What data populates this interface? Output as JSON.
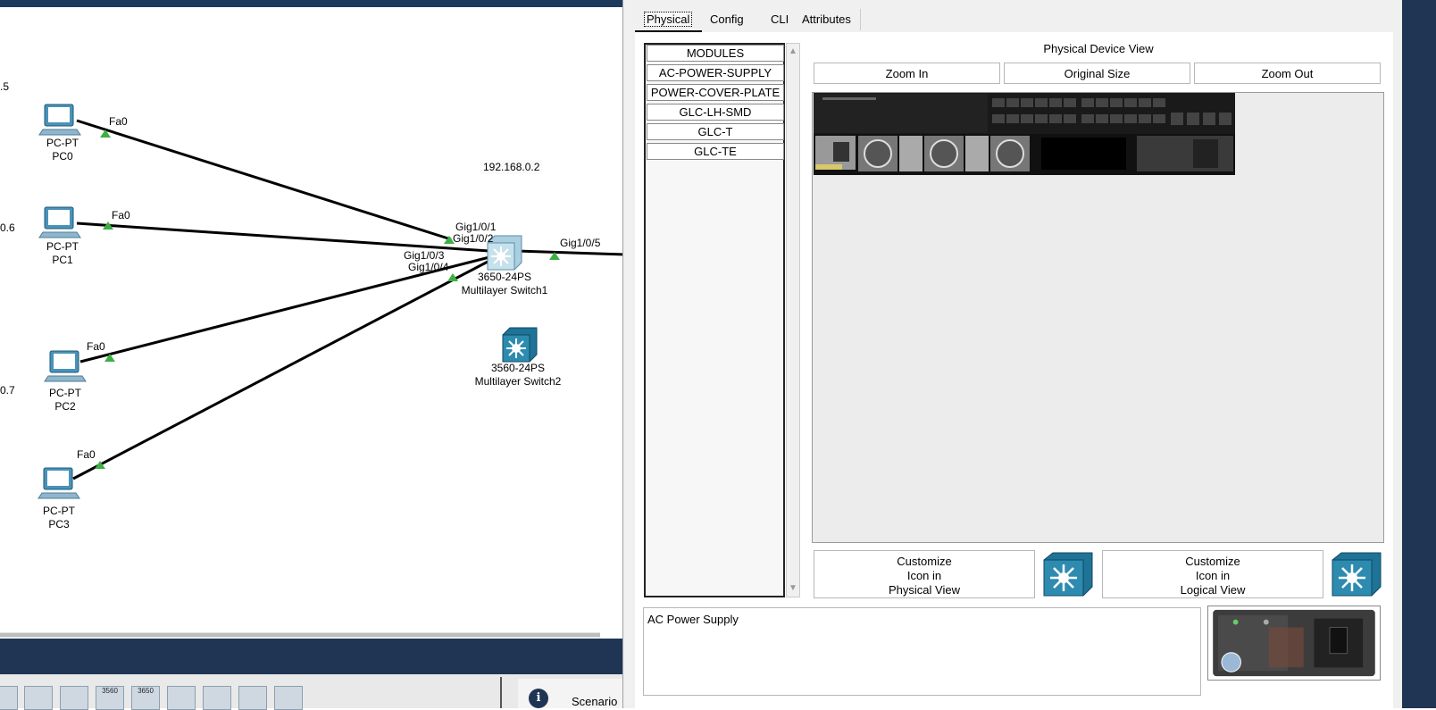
{
  "workspace": {
    "ip_labels": [
      ".5",
      "0.6",
      "0.7",
      "192.168.0.2"
    ],
    "devices": [
      {
        "model": "PC-PT",
        "name": "PC0"
      },
      {
        "model": "PC-PT",
        "name": "PC1"
      },
      {
        "model": "PC-PT",
        "name": "PC2"
      },
      {
        "model": "PC-PT",
        "name": "PC3"
      },
      {
        "model": "3650-24PS",
        "name": "Multilayer Switch1"
      },
      {
        "model": "3560-24PS",
        "name": "Multilayer Switch2"
      }
    ],
    "ports": {
      "pc0": "Fa0",
      "pc1": "Fa0",
      "pc2": "Fa0",
      "pc3": "Fa0",
      "sw_g1": "Gig1/0/1",
      "sw_g2": "Gig1/0/2",
      "sw_g3": "Gig1/0/3",
      "sw_g4": "Gig1/0/4",
      "sw_g5": "Gig1/0/5"
    },
    "device_strip": [
      "",
      "",
      "",
      "3560",
      "3650",
      "",
      "",
      "",
      ""
    ],
    "scenario_label": "Scenario"
  },
  "dialog": {
    "tabs": [
      "Physical",
      "Config",
      "CLI",
      "Attributes"
    ],
    "active_tab": "Physical",
    "modules": [
      "MODULES",
      "AC-POWER-SUPPLY",
      "POWER-COVER-PLATE",
      "GLC-LH-SMD",
      "GLC-T",
      "GLC-TE"
    ],
    "physical_view_title": "Physical Device View",
    "zoom_in": "Zoom In",
    "original_size": "Original Size",
    "zoom_out": "Zoom Out",
    "customize_physical": "Customize\nIcon in\nPhysical View",
    "customize_logical": "Customize\nIcon in\nLogical View",
    "module_description": "AC Power Supply"
  },
  "colors": {
    "link": "#000000",
    "link_up": "#3cb043",
    "device_blue": "#2e8bb0",
    "panel_dark": "#1f3553"
  }
}
